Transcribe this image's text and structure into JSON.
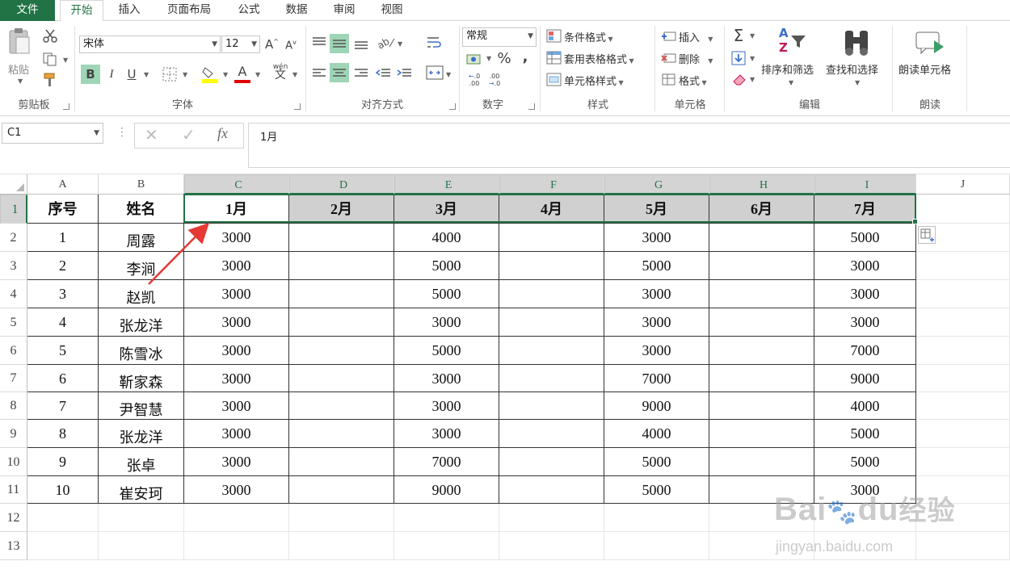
{
  "tabs": [
    {
      "label": "文件",
      "kind": "file"
    },
    {
      "label": "开始",
      "kind": "active"
    },
    {
      "label": "插入",
      "kind": ""
    },
    {
      "label": "页面布局",
      "kind": ""
    },
    {
      "label": "公式",
      "kind": ""
    },
    {
      "label": "数据",
      "kind": ""
    },
    {
      "label": "审阅",
      "kind": ""
    },
    {
      "label": "视图",
      "kind": ""
    }
  ],
  "ribbon": {
    "clipboard": {
      "paste": "粘贴",
      "label": "剪贴板"
    },
    "font": {
      "name": "宋体",
      "size": "12",
      "bold": "B",
      "italic": "I",
      "underline": "U",
      "label": "字体",
      "wen": "wén",
      "wen_char": "文",
      "grow": "A",
      "shrink": "A",
      "color_a": "A"
    },
    "align": {
      "label": "对齐方式"
    },
    "number": {
      "format": "常规",
      "percent": "%",
      "comma": ",",
      "label": "数字",
      "inc": ".00",
      "dec": ".0"
    },
    "styles": {
      "cond": "条件格式",
      "table": "套用表格格式",
      "cell": "单元格样式",
      "label": "样式"
    },
    "cells": {
      "insert": "插入",
      "delete": "删除",
      "format": "格式",
      "label": "单元格"
    },
    "edit": {
      "sort": "排序和筛选",
      "find": "查找和选择",
      "label": "编辑",
      "sigma": "Σ",
      "az_a": "A",
      "az_z": "Z"
    },
    "read": {
      "btn": "朗读单元格",
      "label": "朗读"
    }
  },
  "formula_bar": {
    "name_box": "C1",
    "value": "1月",
    "fx": "fx",
    "cancel": "✕",
    "enter": "✓",
    "dots": "⋮"
  },
  "columns": [
    "A",
    "B",
    "C",
    "D",
    "E",
    "F",
    "G",
    "H",
    "I",
    "J"
  ],
  "rows": [
    "1",
    "2",
    "3",
    "4",
    "5",
    "6",
    "7",
    "8",
    "9",
    "10",
    "11",
    "12",
    "13"
  ],
  "table": {
    "header": [
      "序号",
      "姓名",
      "1月",
      "2月",
      "3月",
      "4月",
      "5月",
      "6月",
      "7月"
    ],
    "data": [
      [
        "1",
        "周露",
        "3000",
        "",
        "4000",
        "",
        "3000",
        "",
        "5000"
      ],
      [
        "2",
        "李涧",
        "3000",
        "",
        "5000",
        "",
        "5000",
        "",
        "3000"
      ],
      [
        "3",
        "赵凯",
        "3000",
        "",
        "5000",
        "",
        "3000",
        "",
        "3000"
      ],
      [
        "4",
        "张龙洋",
        "3000",
        "",
        "3000",
        "",
        "3000",
        "",
        "3000"
      ],
      [
        "5",
        "陈雪冰",
        "3000",
        "",
        "5000",
        "",
        "3000",
        "",
        "7000"
      ],
      [
        "6",
        "靳家森",
        "3000",
        "",
        "3000",
        "",
        "7000",
        "",
        "9000"
      ],
      [
        "7",
        "尹智慧",
        "3000",
        "",
        "3000",
        "",
        "9000",
        "",
        "4000"
      ],
      [
        "8",
        "张龙洋",
        "3000",
        "",
        "3000",
        "",
        "4000",
        "",
        "5000"
      ],
      [
        "9",
        "张卓",
        "3000",
        "",
        "7000",
        "",
        "5000",
        "",
        "5000"
      ],
      [
        "10",
        "崔安珂",
        "3000",
        "",
        "9000",
        "",
        "5000",
        "",
        "3000"
      ]
    ]
  },
  "watermark": {
    "brand_left": "Bai",
    "brand_right": "du",
    "brand_cn": "经验",
    "url": "jingyan.baidu.com"
  },
  "colors": {
    "accent": "#217346",
    "arrow": "#e53935",
    "selected_header": "#d0d0d0"
  }
}
